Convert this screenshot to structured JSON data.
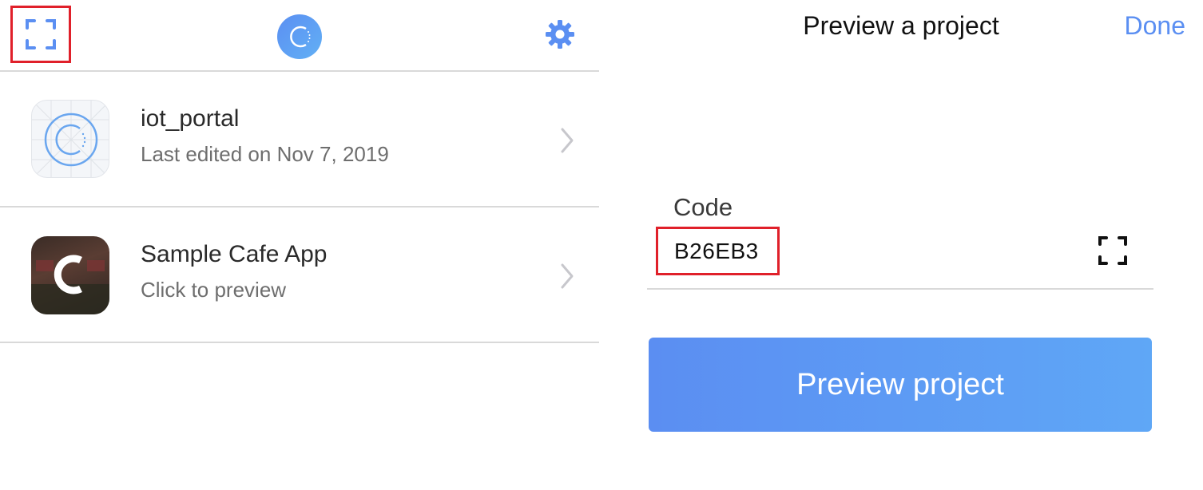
{
  "left": {
    "header": {
      "scan_icon": "scan-qr-icon",
      "logo_icon": "app-logo-icon",
      "settings_icon": "gear-icon"
    },
    "projects": [
      {
        "title": "iot_portal",
        "subtitle": "Last edited on Nov 7, 2019",
        "icon": "project-logo-icon"
      },
      {
        "title": "Sample Cafe App",
        "subtitle": "Click to preview",
        "icon": "cafe-app-icon"
      }
    ]
  },
  "right": {
    "title": "Preview a project",
    "done_label": "Done",
    "code_label": "Code",
    "code_value": "B26EB3",
    "scan_icon": "scan-qr-icon",
    "preview_button": "Preview project"
  },
  "colors": {
    "accent": "#5b8ff2",
    "highlight": "#e0202a"
  }
}
